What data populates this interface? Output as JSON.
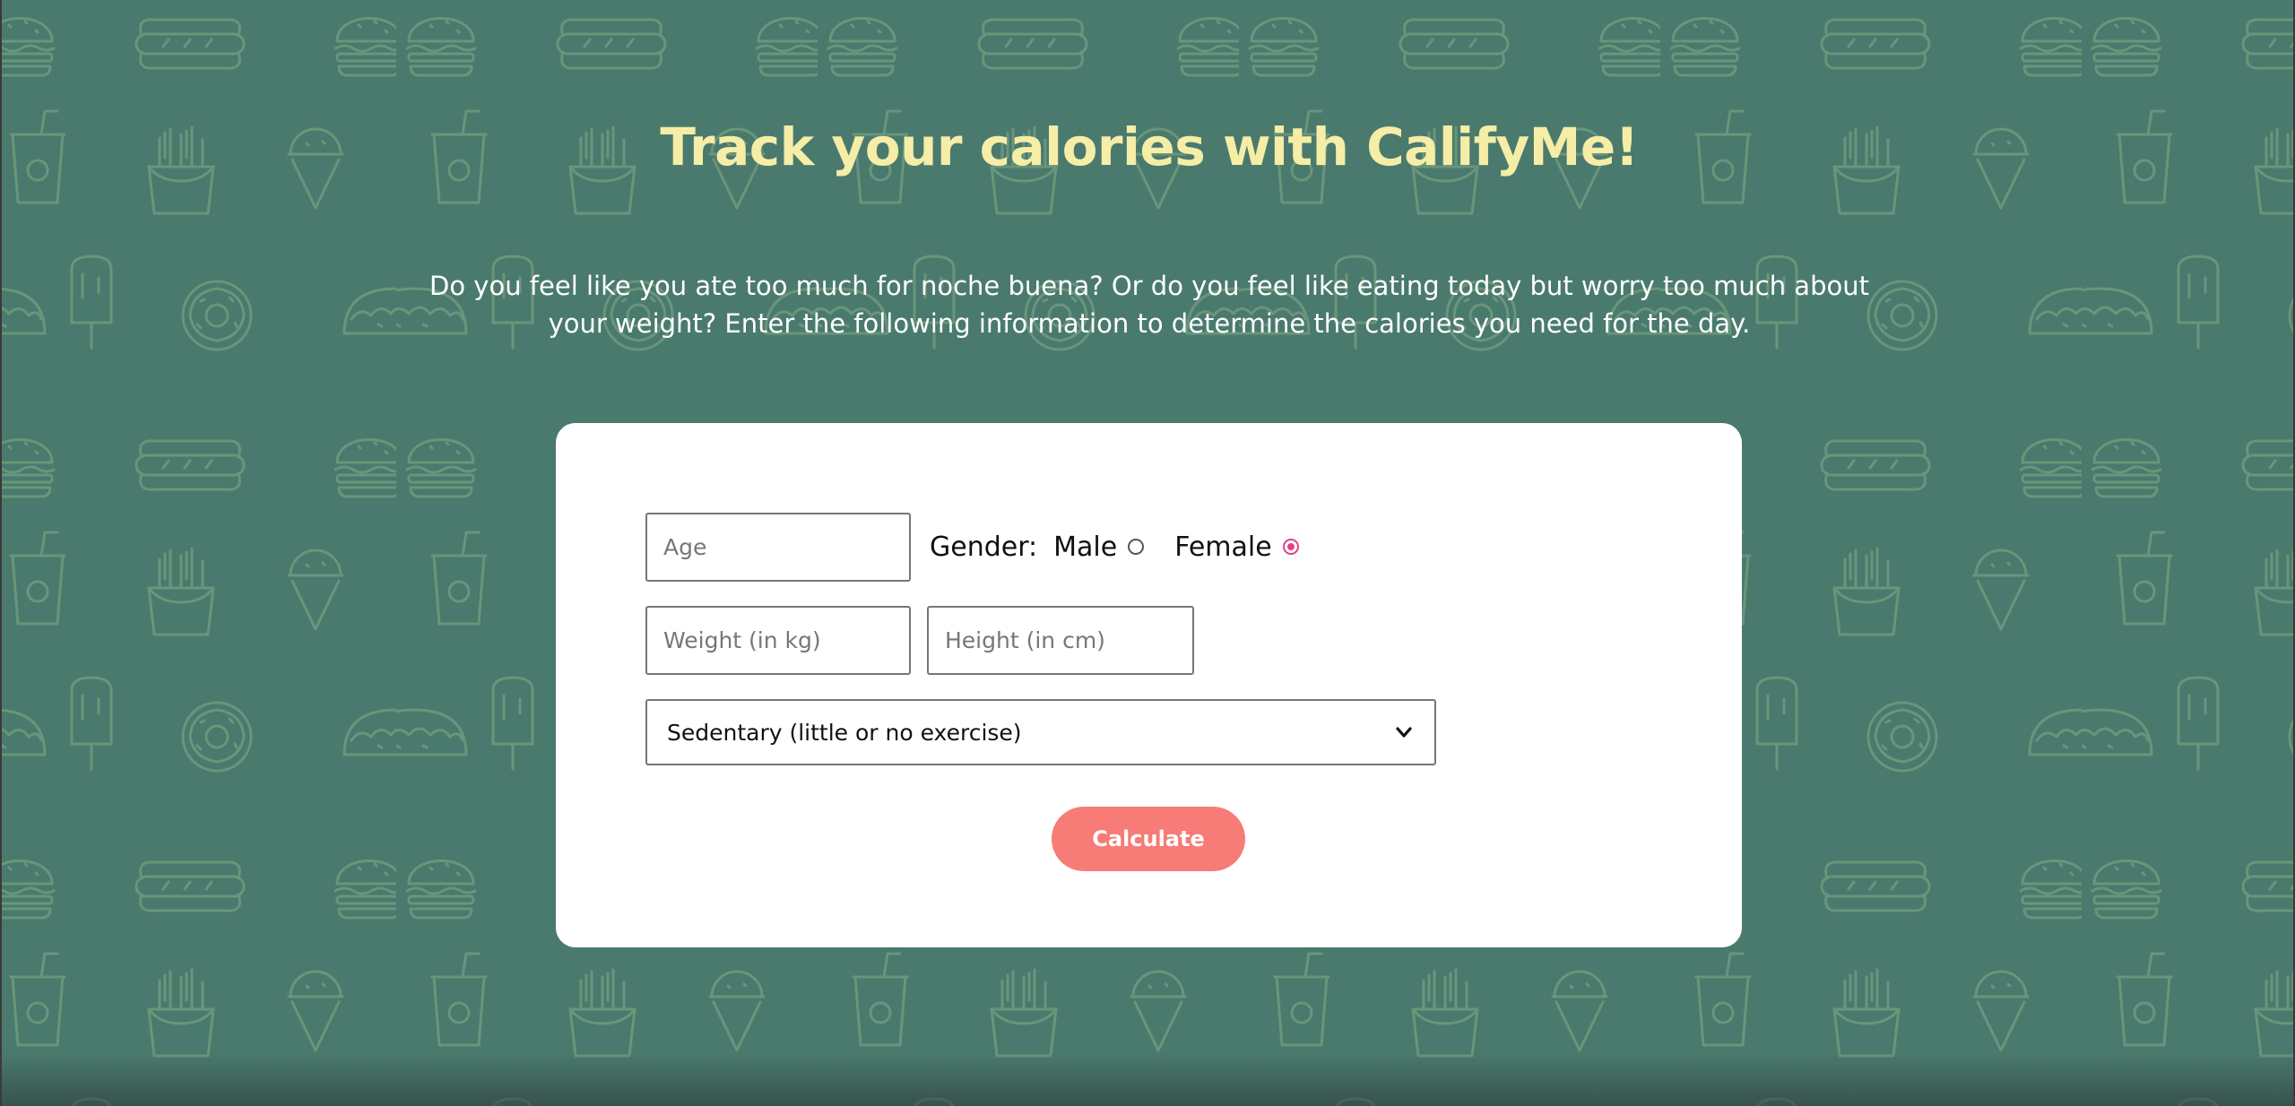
{
  "page": {
    "title": "Track your calories with CalifyMe!",
    "intro": "Do you feel like you ate too much for noche buena? Or do you feel like eating today but worry too much about your weight? Enter the following information to determine the calories you need for the day."
  },
  "form": {
    "age": {
      "placeholder": "Age",
      "value": ""
    },
    "gender": {
      "label": "Gender:",
      "options": [
        {
          "label": "Male",
          "checked": false
        },
        {
          "label": "Female",
          "checked": true
        }
      ]
    },
    "weight": {
      "placeholder": "Weight (in kg)",
      "value": ""
    },
    "height": {
      "placeholder": "Height (in cm)",
      "value": ""
    },
    "activity": {
      "selected": "Sedentary (little or no exercise)"
    },
    "submit_label": "Calculate"
  },
  "background": {
    "pattern_icons": [
      "burger-icon",
      "hotdog-icon",
      "drink-cup-icon",
      "fries-icon",
      "ice-cream-cone-icon",
      "popsicle-icon",
      "taco-icon",
      "donut-icon"
    ]
  },
  "colors": {
    "background": "#4a7a6e",
    "pattern_stroke": "#6f9a7c",
    "title": "#f6eda6",
    "card": "#ffffff",
    "button": "#f77b76",
    "radio_accent": "#e2428a"
  }
}
